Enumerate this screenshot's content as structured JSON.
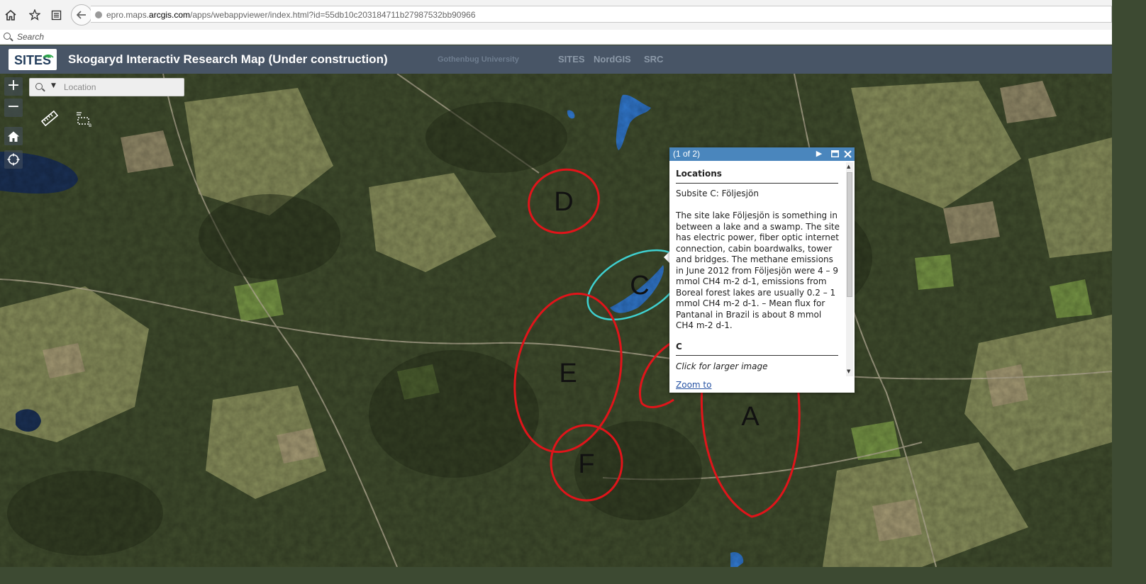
{
  "browser": {
    "url_prefix": "epro.maps.",
    "url_domain": "arcgis.com",
    "url_path": "/apps/webappviewer/index.html?id=55db10c203184711b27987532bb90966",
    "search_placeholder": "Search"
  },
  "header": {
    "logo_text": "SITES",
    "title": "Skogaryd Interactiv Research Map (Under construction)",
    "links": [
      "Gothenbug University",
      "SITES",
      "NordGIS",
      "SRC"
    ]
  },
  "map": {
    "location_placeholder": "Location",
    "zoom_in": "+",
    "zoom_out": "−",
    "sites": [
      {
        "label": "D",
        "color": "#e0141a"
      },
      {
        "label": "C",
        "color": "#3fd0d0"
      },
      {
        "label": "E",
        "color": "#e0141a"
      },
      {
        "label": "F",
        "color": "#e0141a"
      },
      {
        "label": "A",
        "color": "#e0141a"
      }
    ]
  },
  "popup": {
    "count": "(1 of 2)",
    "section_title": "Locations",
    "subsite": "Subsite C: Följesjön",
    "description": "The site lake Följesjön is something in between a lake and a swamp. The site has electric power, fiber optic internet connection, cabin boardwalks, tower and bridges. The methane emissions in June 2012 from Följesjön were 4 – 9 mmol CH4 m-2 d-1, emissions from Boreal forest lakes are usually 0.2 – 1 mmol CH4 m-2 d-1. – Mean flux for Pantanal in Brazil is about 8 mmol CH4 m-2 d-1.",
    "image_section_title": "C",
    "image_caption": "Click for larger image",
    "zoom_link": "Zoom to"
  }
}
